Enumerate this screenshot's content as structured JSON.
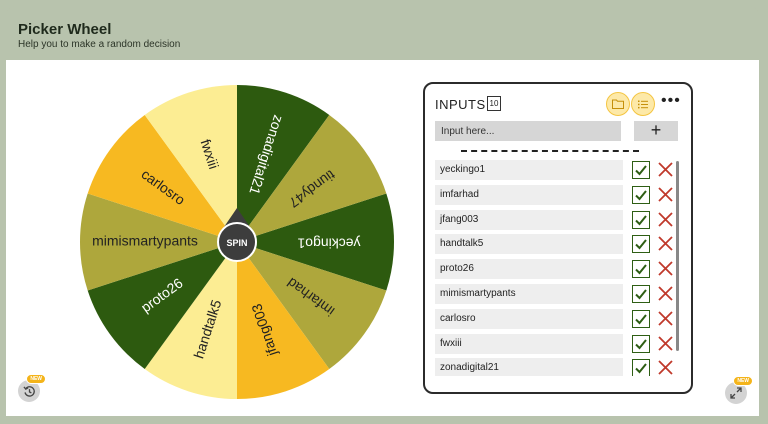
{
  "header": {
    "title": "Picker Wheel",
    "subtitle": "Help you to make a random decision"
  },
  "wheel": {
    "spin_label": "SPIN",
    "segments": [
      {
        "label": "yeckingo1",
        "color": "#2d5a0f"
      },
      {
        "label": "imfarhad",
        "color": "#aea73c"
      },
      {
        "label": "jfang003",
        "color": "#f7b921"
      },
      {
        "label": "handtalk5",
        "color": "#fced93"
      },
      {
        "label": "proto26",
        "color": "#2d5a0f"
      },
      {
        "label": "mimismartypants",
        "color": "#aea73c"
      },
      {
        "label": "carlosro",
        "color": "#f7b921"
      },
      {
        "label": "fwxiii",
        "color": "#fced93"
      },
      {
        "label": "zonadigital21",
        "color": "#2d5a0f"
      },
      {
        "label": "tiundy47",
        "color": "#aea73c"
      }
    ]
  },
  "inputs": {
    "title": "INPUTS",
    "count": "10",
    "placeholder": "Input here...",
    "add_label": "+",
    "more_label": "•••",
    "items": [
      "yeckingo1",
      "imfarhad",
      "jfang003",
      "handtalk5",
      "proto26",
      "mimismartypants",
      "carlosro",
      "fwxiii",
      "zonadigital21"
    ]
  },
  "badges": {
    "new_label": "NEW"
  },
  "icons": {
    "history": "history-icon",
    "fullscreen": "fullscreen-icon",
    "folder": "folder-icon",
    "list": "list-icon",
    "check": "check-icon",
    "cross": "close-icon"
  },
  "colors": {
    "dark_green": "#2d5a0f",
    "olive": "#aea73c",
    "amber": "#f7b921",
    "pale_yellow": "#fced93",
    "cross_red": "#c0392b"
  }
}
